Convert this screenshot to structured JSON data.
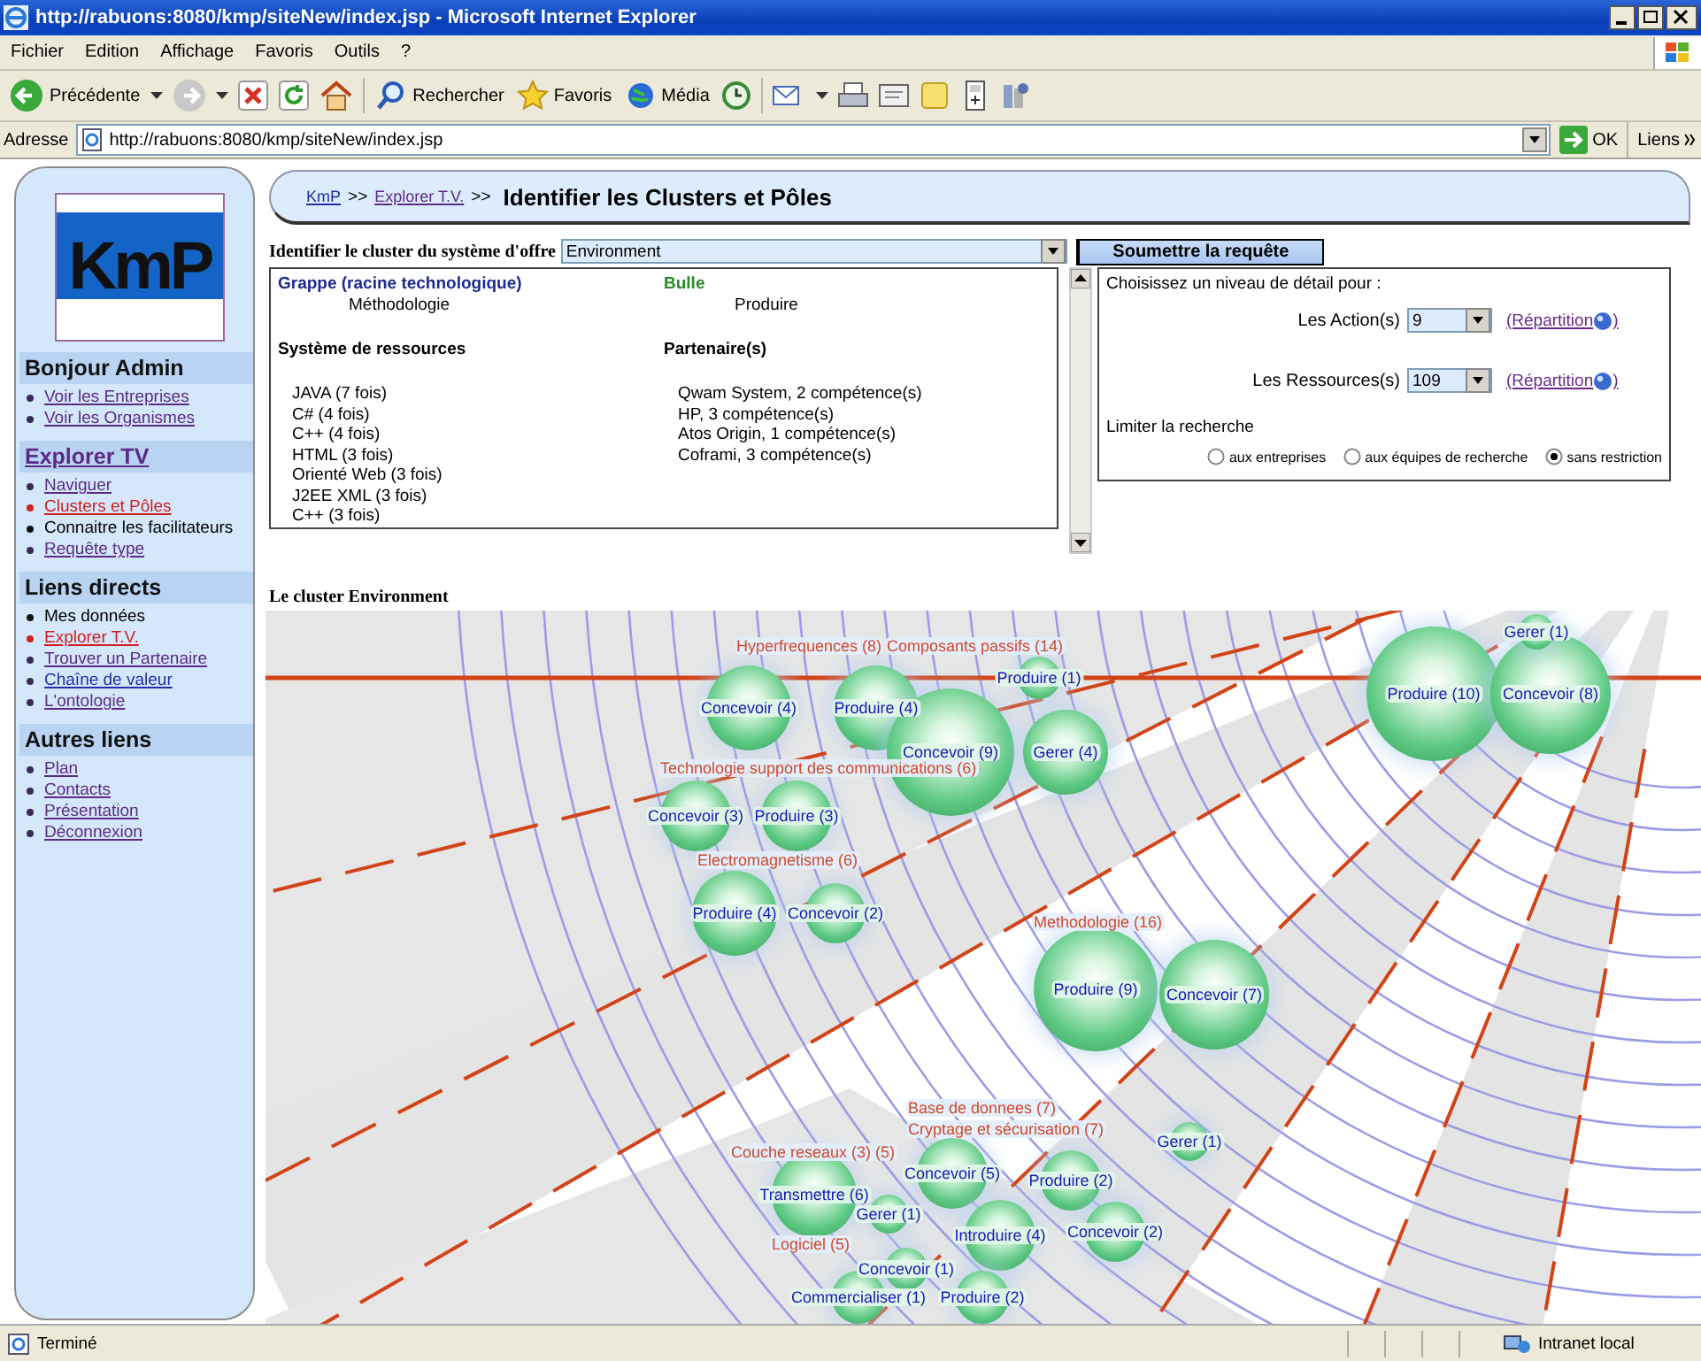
{
  "window": {
    "title": "http://rabuons:8080/kmp/siteNew/index.jsp - Microsoft Internet Explorer"
  },
  "menu_bar": [
    {
      "label": "Fichier"
    },
    {
      "label": "Edition"
    },
    {
      "label": "Affichage"
    },
    {
      "label": "Favoris"
    },
    {
      "label": "Outils"
    },
    {
      "label": "?"
    }
  ],
  "toolbar": {
    "back": "Précédente",
    "search": "Rechercher",
    "favorites": "Favoris",
    "media": "Média"
  },
  "address_bar": {
    "label": "Adresse",
    "url": "http://rabuons:8080/kmp/siteNew/index.jsp",
    "go": "OK",
    "links": "Liens"
  },
  "sidebar": {
    "logo": "KmP",
    "sections": [
      {
        "title": "Bonjour Admin",
        "kind": "text",
        "items": [
          {
            "label": "Voir les Entreprises",
            "kind": "visited"
          },
          {
            "label": "Voir les Organismes",
            "kind": "visited"
          }
        ]
      },
      {
        "title": "Explorer TV",
        "kind": "visited",
        "items": [
          {
            "label": "Naviguer",
            "kind": "visited"
          },
          {
            "label": "Clusters et Pôles",
            "kind": "active"
          },
          {
            "label": "Connaitre les facilitateurs",
            "kind": "text"
          },
          {
            "label": "Requête type",
            "kind": "visited"
          }
        ]
      },
      {
        "title": "Liens directs",
        "kind": "text",
        "items": [
          {
            "label": "Mes données",
            "kind": "text"
          },
          {
            "label": "Explorer T.V.",
            "kind": "active"
          },
          {
            "label": "Trouver un Partenaire",
            "kind": "visited"
          },
          {
            "label": "Chaîne de valeur",
            "kind": "link"
          },
          {
            "label": "L'ontologie",
            "kind": "visited"
          }
        ]
      },
      {
        "title": "Autres liens",
        "kind": "text",
        "items": [
          {
            "label": "Plan",
            "kind": "visited"
          },
          {
            "label": "Contacts",
            "kind": "visited"
          },
          {
            "label": "Présentation",
            "kind": "visited"
          },
          {
            "label": "Déconnexion",
            "kind": "visited"
          }
        ]
      }
    ]
  },
  "breadcrumb": {
    "items": [
      {
        "label": "KmP",
        "kind": "link",
        "separator": ">>"
      },
      {
        "label": "Explorer T.V.",
        "kind": "visited",
        "separator": ">>"
      }
    ],
    "title": "Identifier les Clusters et Pôles"
  },
  "query": {
    "label": "Identifier le cluster du système d'offre",
    "value": "Environment",
    "submit": "Soumettre la requête"
  },
  "info": {
    "grappe": {
      "heading": "Grappe (racine technologique)",
      "value": "Méthodologie"
    },
    "bulle": {
      "heading": "Bulle",
      "value": "Produire"
    },
    "resources": {
      "heading": "Système de ressources",
      "items": [
        "JAVA (7 fois)",
        "C# (4 fois)",
        "C++ (4 fois)",
        "HTML (3 fois)",
        "Orienté Web (3 fois)",
        "J2EE XML (3 fois)",
        "C++ (3 fois)"
      ]
    },
    "partners": {
      "heading": "Partenaire(s)",
      "items": [
        "Qwam System, 2 compétence(s)",
        "HP, 3 compétence(s)",
        "Atos Origin, 1 compétence(s)",
        "Coframi, 3 compétence(s)"
      ]
    }
  },
  "detail": {
    "prompt": "Choisissez un niveau de détail pour :",
    "rows": [
      {
        "label": "Les Action(s)",
        "value": "9",
        "link_open": "(Répartition",
        "link_close": ")"
      },
      {
        "label": "Les Ressources(s)",
        "value": "109",
        "link_open": "(Répartition",
        "link_close": ")"
      }
    ],
    "limit_label": "Limiter la recherche",
    "options": [
      {
        "label": "aux entreprises",
        "selected": false
      },
      {
        "label": "aux équipes de recherche",
        "selected": false
      },
      {
        "label": "sans restriction",
        "selected": true
      }
    ]
  },
  "cluster_title": "Le cluster Environment",
  "clusters": [
    {
      "title": "Hyperfrequences (8)",
      "bubbles": [
        "Concevoir (4)",
        "Produire (4)"
      ]
    },
    {
      "title": "Composants passifs (14)",
      "bubbles": [
        "Concevoir (9)",
        "Produire (1)",
        "Gerer (4)"
      ]
    },
    {
      "title": "Technologie support des communications (6)",
      "bubbles": [
        "Concevoir (3)",
        "Produire (3)"
      ]
    },
    {
      "title": "Electromagnetisme (6)",
      "bubbles": [
        "Produire (4)",
        "Concevoir (2)"
      ]
    },
    {
      "title": "Methodologie (16)",
      "bubbles": [
        "Produire (9)",
        "Concevoir (7)"
      ]
    },
    {
      "bubbles": [
        "Produire (10)",
        "Concevoir (8)",
        "Gerer (1)"
      ]
    },
    {
      "title": "Base de donnees (7)",
      "bubbles": [
        "Concevoir (5)",
        "Introduire (4)"
      ]
    },
    {
      "title": "Cryptage et sécurisation (7)",
      "bubbles": [
        "Gerer (1)",
        "Produire (2)",
        "Concevoir (2)"
      ]
    },
    {
      "title": "Couche reseaux (3) (5)",
      "bubbles": [
        "Transmettre (6)",
        "Gerer (1)"
      ]
    },
    {
      "title": "Logiciel (5)",
      "bubbles": [
        "Concevoir (1)",
        "Commercialiser (1)",
        "Produire (2)"
      ]
    }
  ],
  "status_bar": {
    "text": "Terminé",
    "zone": "Intranet local"
  }
}
